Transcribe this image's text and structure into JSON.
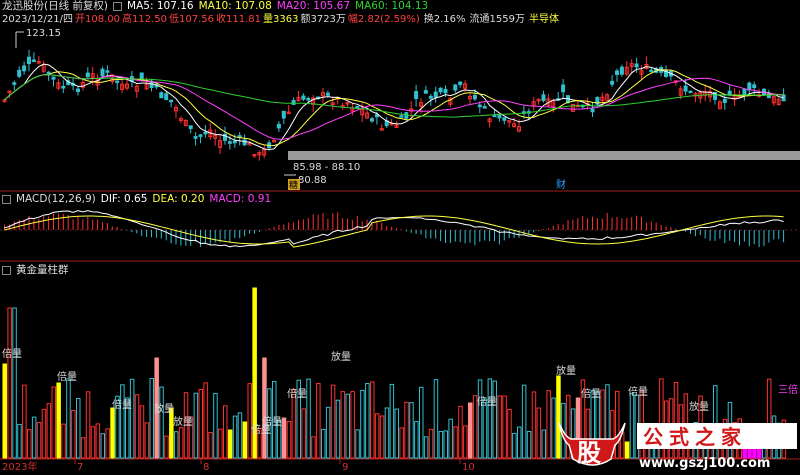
{
  "header": {
    "stock_name": "龙迅股份(日线 前复权)",
    "date_line": "2023/12/21/四",
    "open": "开108.00",
    "high": "高112.50",
    "low": "低107.56",
    "close": "收111.81",
    "volume": "量3363",
    "amount": "额3723万",
    "change": "幅2.82(2.59%)",
    "turnover": "换2.16%",
    "float": "流通1559万",
    "sector": "半导体",
    "ma5": "MA5: 107.16",
    "ma10": "MA10: 107.08",
    "ma20": "MA20: 105.67",
    "ma60": "MA60: 104.13"
  },
  "macd_header": {
    "name": "MACD(12,26,9)",
    "dif": "DIF: 0.65",
    "dea": "DEA: 0.20",
    "macd": "MACD: 0.91"
  },
  "vol_header": {
    "name": "黄金量柱群"
  },
  "price_annotations": {
    "high_label": "123.15",
    "low_label": "80.88",
    "range_label": "85.98 - 88.10",
    "mark1": "糖",
    "mark2": "财"
  },
  "x_axis": {
    "labels": [
      "2023年",
      "7",
      "8",
      "9",
      "10"
    ]
  },
  "vol_labels": [
    "倍量",
    "倍量",
    "倍量",
    "放量",
    "放量",
    "倍量",
    "倍量",
    "倍量",
    "放量",
    "倍量",
    "放量",
    "倍量",
    "放量",
    "倍量",
    "三倍"
  ],
  "watermark": {
    "big_char": "股",
    "site_name": "公式之家",
    "url": "www.gszj100.com"
  },
  "colors": {
    "up": "#ff3030",
    "down": "#30c0d0",
    "ma5": "#ffffff",
    "ma10": "#ffff40",
    "ma20": "#ff40ff",
    "ma60": "#30d030",
    "yellow": "#ffff00",
    "pink": "#ff9090",
    "magenta": "#ff00ff"
  },
  "chart_data": [
    {
      "type": "candlestick",
      "title": "龙迅股份(日线 前复权)",
      "series": [
        {
          "name": "MA5"
        },
        {
          "name": "MA10"
        },
        {
          "name": "MA20"
        },
        {
          "name": "MA60"
        }
      ],
      "max_label": 123.15,
      "min_label": 80.88,
      "last_close": 111.81
    },
    {
      "type": "bar",
      "title": "MACD(12,26,9)",
      "series": [
        {
          "name": "DIF",
          "last": 0.65
        },
        {
          "name": "DEA",
          "last": 0.2
        },
        {
          "name": "MACD",
          "last": 0.91
        }
      ]
    },
    {
      "type": "bar",
      "title": "黄金量柱群",
      "categories": [
        "2023年",
        "7",
        "8",
        "9",
        "10"
      ]
    }
  ]
}
